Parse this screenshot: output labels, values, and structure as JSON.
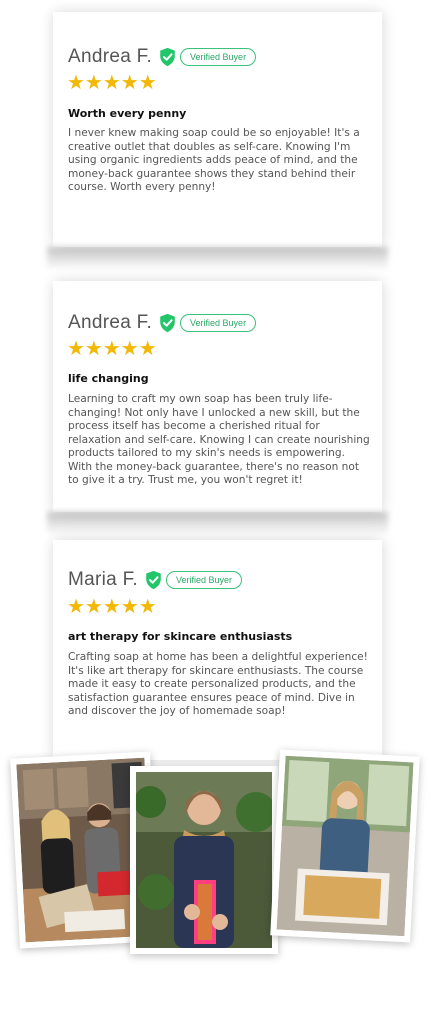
{
  "reviews": [
    {
      "name": "Andrea F.",
      "badge": "Verified Buyer",
      "stars": "★★★★★",
      "title": "Worth every penny",
      "body": "I never knew making soap could be so enjoyable! It's a creative outlet that doubles as self-care. Knowing I'm using organic ingredients adds peace of mind, and the money-back guarantee shows they stand behind their course. Worth every penny!"
    },
    {
      "name": "Andrea F.",
      "badge": "Verified Buyer",
      "stars": "★★★★★",
      "title": "life changing",
      "body": "Learning to craft my own soap has been truly life-changing! Not only have I unlocked a new skill, but the process itself has become a cherished ritual for relaxation and self-care. Knowing I can create nourishing products tailored to my skin's needs is empowering. With the money-back guarantee, there's no reason not to give it a try. Trust me, you won't regret it!"
    },
    {
      "name": "Maria F.",
      "badge": "Verified Buyer",
      "stars": "★★★★★",
      "title": "art therapy for skincare enthusiasts",
      "body": "Crafting soap at home has been a delightful experience! It's like art therapy for skincare enthusiasts. The course made it easy to create personalized products, and the satisfaction guarantee ensures peace of mind. Dive in and discover the joy of homemade soap!"
    }
  ],
  "colors": {
    "star": "#f2b807",
    "verified_green": "#22c56a"
  }
}
